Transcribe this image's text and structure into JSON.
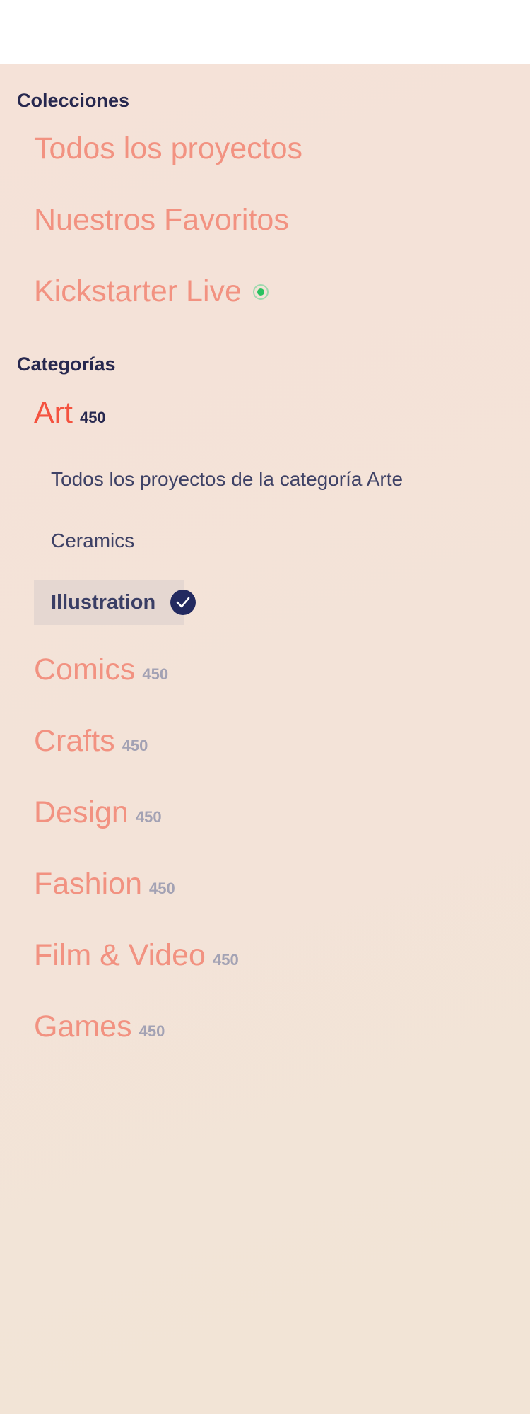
{
  "collections": {
    "title": "Colecciones",
    "items": [
      {
        "label": "Todos los proyectos"
      },
      {
        "label": "Nuestros Favoritos"
      },
      {
        "label": "Kickstarter Live",
        "live_indicator_color": "#29c160"
      }
    ]
  },
  "categories": {
    "title": "Categorías",
    "active": {
      "label": "Art",
      "count": "450",
      "subcategories": {
        "all_label": "Todos los proyectos de la categoría Arte",
        "items": [
          "Ceramics"
        ],
        "selected": "Illustration",
        "selected_icon": "check-icon"
      }
    },
    "items": [
      {
        "label": "Comics",
        "count": "450"
      },
      {
        "label": "Crafts",
        "count": "450"
      },
      {
        "label": "Design",
        "count": "450"
      },
      {
        "label": "Fashion",
        "count": "450"
      },
      {
        "label": "Film & Video",
        "count": "450"
      },
      {
        "label": "Games",
        "count": "450"
      }
    ]
  },
  "colors": {
    "heading": "#27284f",
    "link": "#f29281",
    "active_link": "#f4523f",
    "count": "#a3a2b4",
    "selected_bg": "#e5d7d1",
    "check_badge": "#232a60"
  }
}
